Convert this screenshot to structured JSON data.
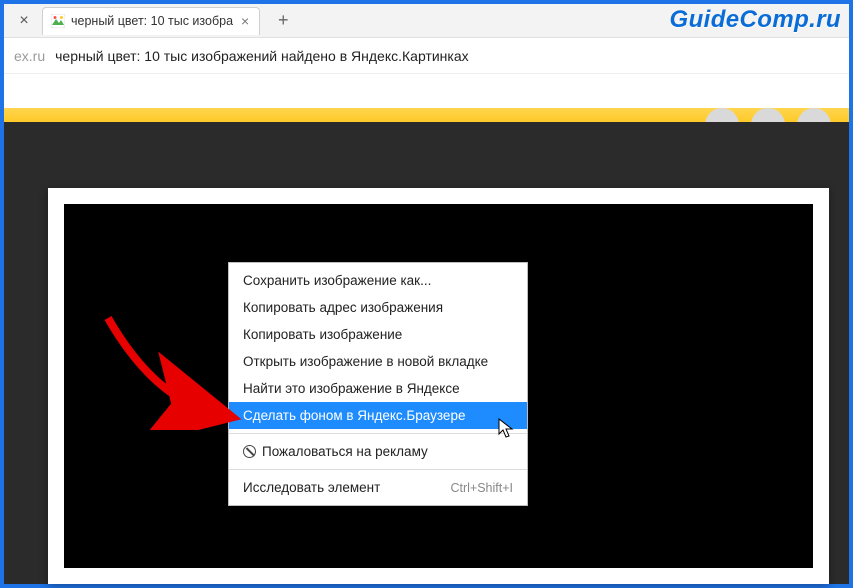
{
  "watermark": "GuideComp.ru",
  "tab": {
    "title": "черный цвет: 10 тыс изобра"
  },
  "address": {
    "domain_fragment": "ex.ru",
    "page_title": "черный цвет: 10 тыс изображений найдено в Яндекс.Картинках"
  },
  "context_menu": {
    "items": [
      {
        "label": "Сохранить изображение как...",
        "highlight": false
      },
      {
        "label": "Копировать адрес изображения",
        "highlight": false
      },
      {
        "label": "Копировать изображение",
        "highlight": false
      },
      {
        "label": "Открыть изображение в новой вкладке",
        "highlight": false
      },
      {
        "label": "Найти это изображение в Яндексе",
        "highlight": false
      },
      {
        "label": "Сделать фоном в Яндекс.Браузере",
        "highlight": true
      },
      {
        "label": "Пожаловаться на рекламу",
        "highlight": false,
        "icon": "prohibit"
      },
      {
        "label": "Исследовать элемент",
        "highlight": false,
        "shortcut": "Ctrl+Shift+I"
      }
    ]
  }
}
